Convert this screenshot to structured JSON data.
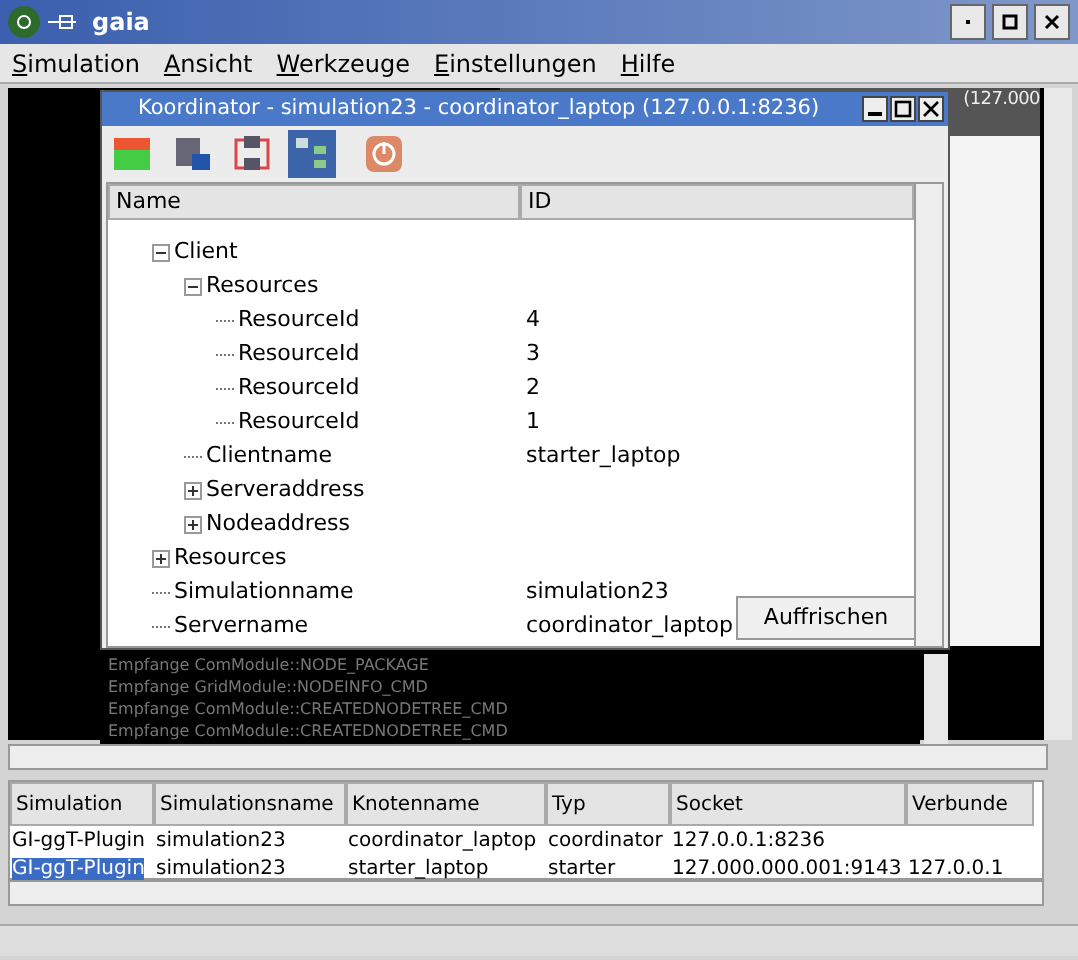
{
  "window": {
    "title": "gaia"
  },
  "menu": [
    "Simulation",
    "Ansicht",
    "Werkzeuge",
    "Einstellungen",
    "Hilfe"
  ],
  "background_window": {
    "title_fragment": "(127.000"
  },
  "coordinator": {
    "title": "Koordinator - simulation23 - coordinator_laptop (127.0.0.1:8236)",
    "toolbar": [
      {
        "kind": "chart",
        "selected": false
      },
      {
        "kind": "computer",
        "selected": false
      },
      {
        "kind": "network",
        "selected": false
      },
      {
        "kind": "tree",
        "selected": true
      },
      {
        "kind": "power",
        "selected": false
      }
    ],
    "columns": [
      "Name",
      "ID"
    ],
    "tree": [
      {
        "name": "Client",
        "expanded": true,
        "children": [
          {
            "name": "Resources",
            "expanded": true,
            "children": [
              {
                "name": "ResourceId",
                "id": "4"
              },
              {
                "name": "ResourceId",
                "id": "3"
              },
              {
                "name": "ResourceId",
                "id": "2"
              },
              {
                "name": "ResourceId",
                "id": "1"
              }
            ]
          },
          {
            "name": "Clientname",
            "id": "starter_laptop"
          },
          {
            "name": "Serveraddress",
            "expanded": false
          },
          {
            "name": "Nodeaddress",
            "expanded": false
          }
        ]
      },
      {
        "name": "Resources",
        "expanded": false
      },
      {
        "name": "Simulationname",
        "id": "simulation23"
      },
      {
        "name": "Servername",
        "id": "coordinator_laptop"
      }
    ],
    "refresh_button": "Auffrischen"
  },
  "log": [
    "Empfange ComModule::NODE_PACKAGE",
    "Empfange GridModule::NODEINFO_CMD",
    "Empfange ComModule::CREATEDNODETREE_CMD",
    "Empfange ComModule::CREATEDNODETREE_CMD"
  ],
  "table": {
    "columns": [
      "Simulation",
      "Simulationsname",
      "Knotenname",
      "Typ",
      "Socket",
      "Verbunde"
    ],
    "rows": [
      {
        "selected": false,
        "cells": [
          "GI-ggT-Plugin",
          "simulation23",
          "coordinator_laptop",
          "coordinator",
          "127.0.0.1:8236",
          ""
        ]
      },
      {
        "selected": true,
        "cells": [
          "GI-ggT-Plugin",
          "simulation23",
          "starter_laptop",
          "starter",
          "127.000.000.001:9143",
          "127.0.0.1"
        ]
      }
    ]
  }
}
